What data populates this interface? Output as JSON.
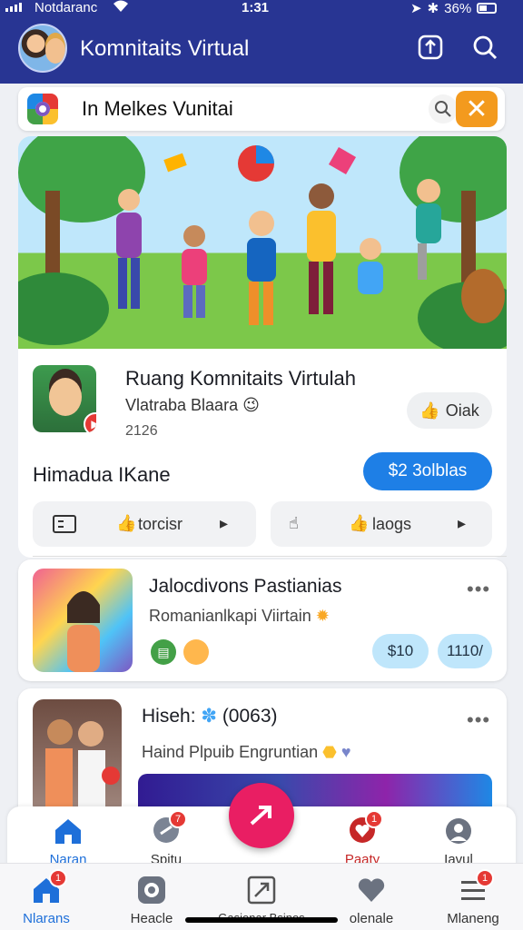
{
  "status_bar": {
    "carrier": "Notdaranc",
    "time": "1:31",
    "battery": "36%"
  },
  "header": {
    "title": "Komnitaits Virtual"
  },
  "search": {
    "value": "In Melkes Vunitai"
  },
  "community": {
    "title": "Ruang Komnitaits Virtulah",
    "subtitle": "Vlatraba Blaara",
    "count": "2126",
    "like_label": "Oiak",
    "host_name": "Himadua IKane",
    "price_label": "$2 3olblas",
    "pills": [
      "torcisr",
      "laogs"
    ]
  },
  "feed": [
    {
      "title": "Jalocdivons Pastianias",
      "subtitle": "Romanianlkapi Viirtain",
      "tags": [
        "$10",
        "1110/"
      ]
    },
    {
      "title": "Hiseh:",
      "count": "(0063)",
      "subtitle": "Haind Plpuib Engruntian"
    }
  ],
  "tabbar_upper": {
    "items": [
      {
        "label": "Naran",
        "icon": "home-icon"
      },
      {
        "label": "Spitu",
        "icon": "chat-icon",
        "badge": "7"
      },
      {
        "label": "Paaty",
        "icon": "chat-heart-icon",
        "badge": "1"
      },
      {
        "label": "Iavul",
        "icon": "settings-icon"
      }
    ]
  },
  "tabbar_lower": {
    "items": [
      {
        "label": "Nlarans",
        "icon": "home-icon",
        "badge": "1"
      },
      {
        "label": "Heacle",
        "icon": "apps-icon"
      },
      {
        "label": "Gasionar Bsinos",
        "icon": "share-icon"
      },
      {
        "label": "olenale",
        "icon": "heart-icon"
      },
      {
        "label": "Mlaneng",
        "icon": "menu-icon",
        "badge": "1"
      }
    ]
  },
  "colors": {
    "header": "#283593",
    "primary_button": "#1e7fe6",
    "fab": "#e91e63",
    "badge": "#e53935",
    "close_button": "#f39a1e"
  }
}
